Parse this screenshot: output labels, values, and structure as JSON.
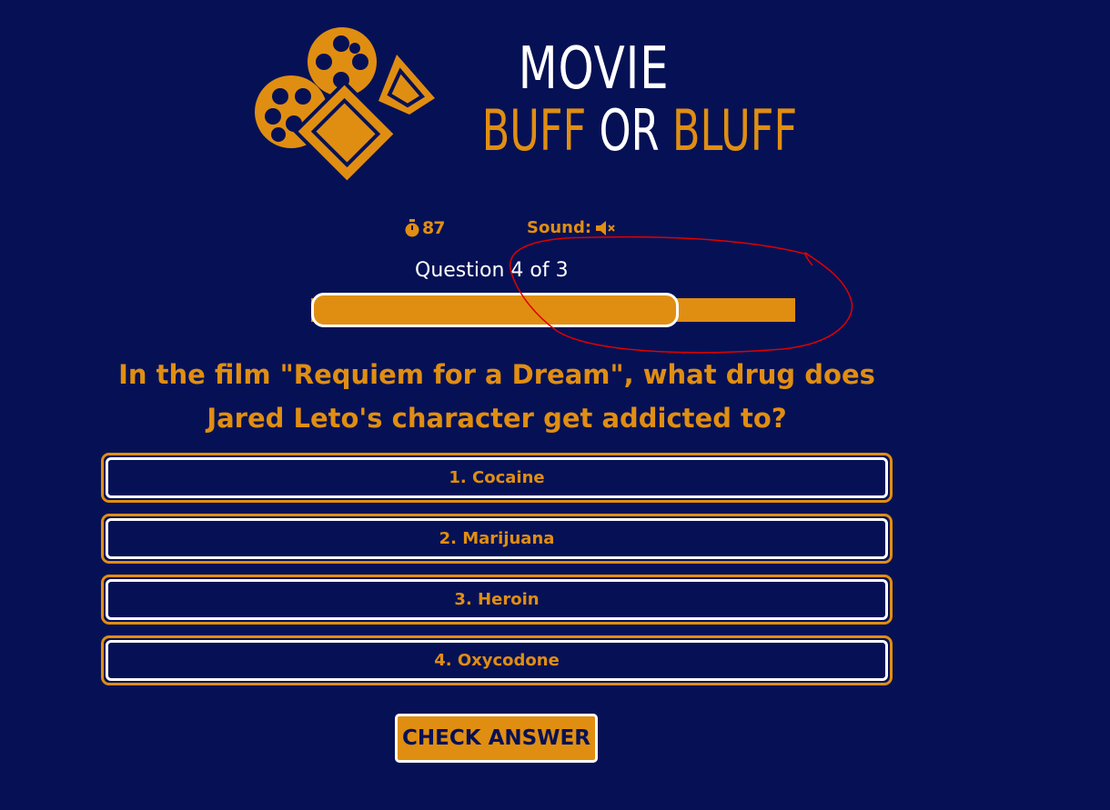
{
  "header": {
    "title_line1": "MOVIE",
    "title_word1": "BUFF",
    "title_word2": "OR",
    "title_word3": "BLUFF",
    "logo_icon": "movie-camera-icon"
  },
  "status": {
    "timer_icon": "stopwatch-icon",
    "timer_value": "87",
    "sound_label": "Sound:",
    "sound_icon": "speaker-muted-icon"
  },
  "progress": {
    "counter_text": "Question 4 of 3",
    "fill_fraction": 0.76
  },
  "question": {
    "text": "In the film \"Requiem for a Dream\", what drug does Jared Leto's character get addicted to?"
  },
  "answers": [
    {
      "label": "1. Cocaine"
    },
    {
      "label": "2. Marijuana"
    },
    {
      "label": "3. Heroin"
    },
    {
      "label": "4. Oxycodone"
    }
  ],
  "actions": {
    "check_label": "CHECK ANSWER"
  },
  "colors": {
    "background": "#061155",
    "accent": "#e08e12",
    "text_light": "#ffffff",
    "annotation": "#e00000"
  }
}
